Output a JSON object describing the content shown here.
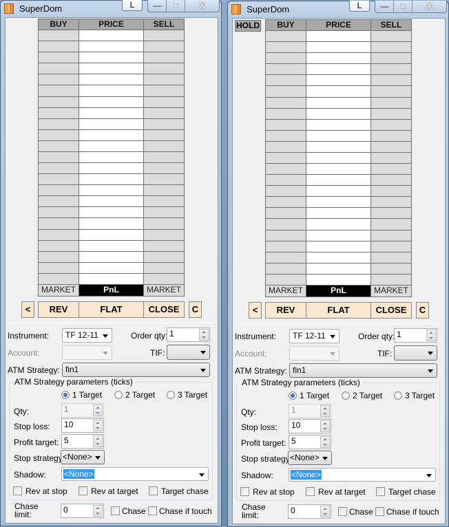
{
  "windows": [
    {
      "title": "SuperDom",
      "l_button": "L",
      "caption_buttons": {
        "minimize": "—",
        "maximize": "□",
        "close": "X"
      },
      "hold_button": null,
      "ladder": {
        "headers": {
          "buy": "BUY",
          "price": "PRICE",
          "sell": "SELL"
        },
        "footer": {
          "buy_market": "MARKET",
          "pnl": "PnL",
          "sell_market": "MARKET"
        }
      },
      "actions": {
        "left": "<",
        "rev": "REV",
        "flat": "FLAT",
        "close": "CLOSE",
        "c": "C"
      },
      "instrument": {
        "label": "Instrument:",
        "value": "TF 12-11"
      },
      "order_qty": {
        "label": "Order qty:",
        "value": "1"
      },
      "account": {
        "label": "Account:",
        "value": ""
      },
      "tif": {
        "label": "TIF:",
        "value": ""
      },
      "atm_strategy": {
        "label": "ATM Strategy:",
        "value": "fin1"
      },
      "params": {
        "title": "ATM Strategy parameters (ticks)",
        "targets": [
          {
            "label": "1 Target",
            "selected": true
          },
          {
            "label": "2 Target",
            "selected": false
          },
          {
            "label": "3 Target",
            "selected": false
          }
        ],
        "qty": {
          "label": "Qty:",
          "value": "1"
        },
        "stop_loss": {
          "label": "Stop loss:",
          "value": "10"
        },
        "profit_target": {
          "label": "Profit target:",
          "value": "5"
        },
        "stop_strategy": {
          "label": "Stop strategy:",
          "value": "<None>"
        },
        "shadow": {
          "label": "Shadow:",
          "value": "<None>"
        },
        "checks": [
          {
            "label": "Rev at stop",
            "checked": false
          },
          {
            "label": "Rev at target",
            "checked": false
          },
          {
            "label": "Target chase",
            "checked": false
          }
        ]
      },
      "chase_limit": {
        "label_line1": "Chase",
        "label_line2": "limit:",
        "value": "0"
      },
      "chase": {
        "label": "Chase",
        "checked": false
      },
      "chase_if_touch": {
        "label": "Chase if touch",
        "checked": false
      }
    },
    {
      "title": "SuperDom",
      "l_button": "L",
      "caption_buttons": {
        "minimize": "—",
        "maximize": "□",
        "close": "X"
      },
      "hold_button": "HOLD",
      "ladder": {
        "headers": {
          "buy": "BUY",
          "price": "PRICE",
          "sell": "SELL"
        },
        "footer": {
          "buy_market": "MARKET",
          "pnl": "PnL",
          "sell_market": "MARKET"
        }
      },
      "actions": {
        "left": "<",
        "rev": "REV",
        "flat": "FLAT",
        "close": "CLOSE",
        "c": "C"
      },
      "instrument": {
        "label": "Instrument:",
        "value": "TF 12-11"
      },
      "order_qty": {
        "label": "Order qty:",
        "value": "1"
      },
      "account": {
        "label": "Account:",
        "value": ""
      },
      "tif": {
        "label": "TIF:",
        "value": ""
      },
      "atm_strategy": {
        "label": "ATM Strategy:",
        "value": "fin1"
      },
      "params": {
        "title": "ATM Strategy parameters (ticks)",
        "targets": [
          {
            "label": "1 Target",
            "selected": true
          },
          {
            "label": "2 Target",
            "selected": false
          },
          {
            "label": "3 Target",
            "selected": false
          }
        ],
        "qty": {
          "label": "Qty:",
          "value": "1"
        },
        "stop_loss": {
          "label": "Stop loss:",
          "value": "10"
        },
        "profit_target": {
          "label": "Profit target:",
          "value": "5"
        },
        "stop_strategy": {
          "label": "Stop strategy:",
          "value": "<None>"
        },
        "shadow": {
          "label": "Shadow:",
          "value": "<None>"
        },
        "checks": [
          {
            "label": "Rev at stop",
            "checked": false
          },
          {
            "label": "Rev at target",
            "checked": false
          },
          {
            "label": "Target chase",
            "checked": false
          }
        ]
      },
      "chase_limit": {
        "label_line1": "Chase",
        "label_line2": "limit:",
        "value": "0"
      },
      "chase": {
        "label": "Chase",
        "checked": false
      },
      "chase_if_touch": {
        "label": "Chase if touch",
        "checked": false
      }
    }
  ]
}
